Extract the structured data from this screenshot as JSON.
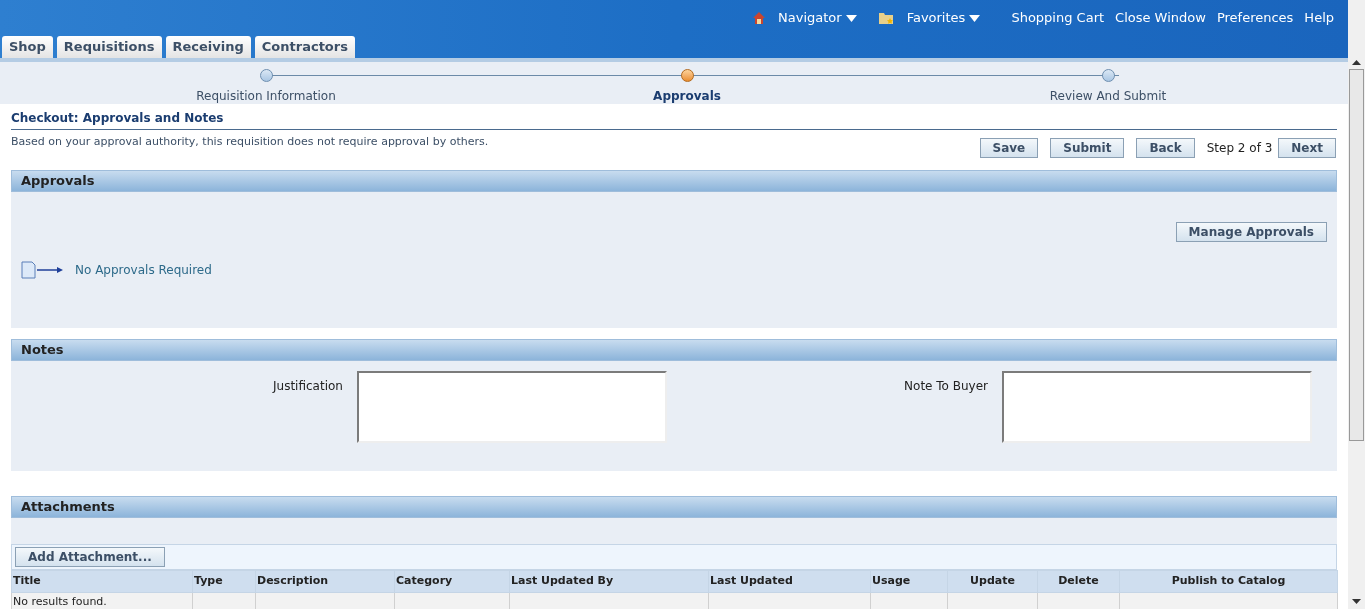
{
  "header": {
    "navigator": "Navigator",
    "favorites": "Favorites",
    "links": [
      "Shopping Cart",
      "Close Window",
      "Preferences",
      "Help"
    ]
  },
  "tabs": [
    {
      "label": "Shop",
      "selected": false
    },
    {
      "label": "Requisitions",
      "selected": false
    },
    {
      "label": "Receiving",
      "selected": false
    },
    {
      "label": "Contractors",
      "selected": false
    }
  ],
  "train": [
    {
      "label": "Requisition Information",
      "selected": false
    },
    {
      "label": "Approvals",
      "selected": true
    },
    {
      "label": "Review And Submit",
      "selected": false
    }
  ],
  "page": {
    "title": "Checkout: Approvals and Notes",
    "instruction": "Based on your approval authority, this requisition does not require approval by others.",
    "buttons": [
      "Save",
      "Submit",
      "Back"
    ],
    "step": "Step 2 of 3",
    "next": "Next"
  },
  "approvals": {
    "title": "Approvals",
    "button": "Manage Approvals",
    "message": "No Approvals Required"
  },
  "notes": {
    "title": "Notes",
    "fields": [
      {
        "label": "Justification"
      },
      {
        "label": "Note To Buyer"
      }
    ]
  },
  "attachments": {
    "title": "Attachments",
    "button": "Add Attachment...",
    "columns": [
      {
        "label": "Title"
      },
      {
        "label": "Type"
      },
      {
        "label": "Description"
      },
      {
        "label": "Category"
      },
      {
        "label": "Last Updated By"
      },
      {
        "label": "Last Updated"
      },
      {
        "label": "Usage"
      },
      {
        "label": "Update"
      },
      {
        "label": "Delete"
      },
      {
        "label": "Publish to Catalog"
      }
    ],
    "empty": "No results found."
  }
}
